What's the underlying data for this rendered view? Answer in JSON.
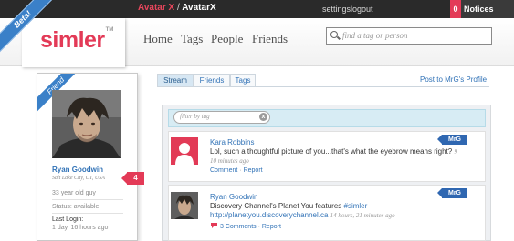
{
  "topbar": {
    "alias": "Avatar X",
    "separator": "/",
    "username": "AvatarX",
    "settings": "settings",
    "logout": "logout",
    "notices_count": "0",
    "notices_label": "Notices"
  },
  "brand": {
    "logo": "simler",
    "tm": "TM",
    "beta": "Beta!"
  },
  "nav": [
    "Home",
    "Tags",
    "People",
    "Friends"
  ],
  "search": {
    "placeholder": "find a tag or person"
  },
  "profile": {
    "ribbon": "Friend",
    "name": "Ryan Goodwin",
    "location": "Salt Lake City, UT, USA",
    "badge_count": "4",
    "age": "33 year old guy",
    "status": "Status: available",
    "last_login_label": "Last Login:",
    "last_login_value": "1 day, 16 hours ago"
  },
  "tabs": [
    {
      "label": "Stream",
      "active": true
    },
    {
      "label": "Friends",
      "active": false
    },
    {
      "label": "Tags",
      "active": false
    }
  ],
  "post_link": "Post to MrG's Profile",
  "filter": {
    "placeholder": "filter by tag",
    "clear": "x"
  },
  "stream": [
    {
      "author": "Kara Robbins",
      "text": "Lol, such a thoughtful picture of you...that's what the eyebrow means right?",
      "time_lead": "9",
      "time_rest": "10 minutes ago",
      "actions": [
        "Comment",
        "Report"
      ],
      "tag": "MrG"
    },
    {
      "author": "Ryan Goodwin",
      "text": "Discovery Channel's Planet You features",
      "hashtag": "#simler",
      "link": "http://planetyou.discoverychannel.ca",
      "time": "14 hours, 21 minutes ago",
      "comments": "3 Comments",
      "actions": [
        "Report"
      ],
      "tag": "MrG"
    }
  ],
  "colors": {
    "brand": "#e33a57",
    "link": "#3273b7",
    "ribbon": "#3a80c8",
    "topbar": "#2a2a2a"
  }
}
